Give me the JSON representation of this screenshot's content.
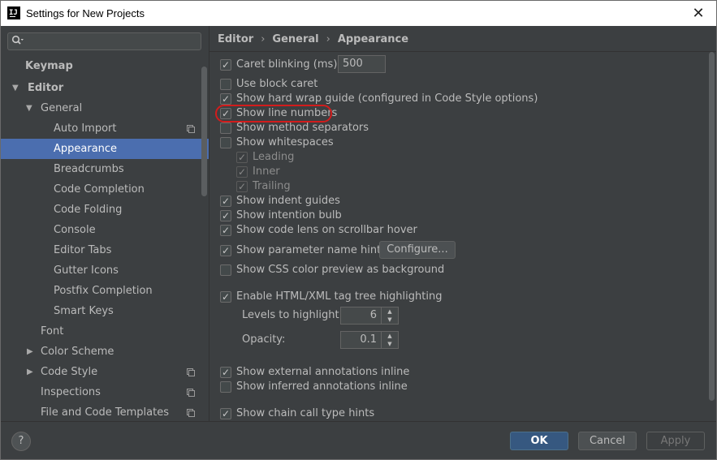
{
  "window": {
    "title": "Settings for New Projects",
    "app_icon_text": "IJ",
    "close_glyph": "✕"
  },
  "sidebar": {
    "search": {
      "value": "",
      "icon": "search-icon"
    },
    "items": [
      {
        "label": "Keymap"
      },
      {
        "label": "Editor",
        "arrow": "▼"
      },
      {
        "label": "General",
        "arrow": "▼"
      },
      {
        "label": "Auto Import"
      },
      {
        "label": "Appearance"
      },
      {
        "label": "Breadcrumbs"
      },
      {
        "label": "Code Completion"
      },
      {
        "label": "Code Folding"
      },
      {
        "label": "Console"
      },
      {
        "label": "Editor Tabs"
      },
      {
        "label": "Gutter Icons"
      },
      {
        "label": "Postfix Completion"
      },
      {
        "label": "Smart Keys"
      },
      {
        "label": "Font"
      },
      {
        "label": "Color Scheme",
        "arrow": "▶"
      },
      {
        "label": "Code Style",
        "arrow": "▶"
      },
      {
        "label": "Inspections"
      },
      {
        "label": "File and Code Templates"
      }
    ]
  },
  "breadcrumb": {
    "part1": "Editor",
    "part2": "General",
    "part3": "Appearance",
    "sep": "›"
  },
  "settings": {
    "caret_blinking": {
      "label": "Caret blinking (ms):",
      "value": "500",
      "checked": true
    },
    "use_block_caret": {
      "label": "Use block caret",
      "checked": false
    },
    "hard_wrap_guide": {
      "label": "Show hard wrap guide (configured in Code Style options)",
      "checked": true
    },
    "line_numbers": {
      "label": "Show line numbers",
      "checked": true
    },
    "method_separators": {
      "label": "Show method separators",
      "checked": false
    },
    "whitespaces": {
      "label": "Show whitespaces",
      "checked": false
    },
    "leading": {
      "label": "Leading",
      "checked": true
    },
    "inner": {
      "label": "Inner",
      "checked": true
    },
    "trailing": {
      "label": "Trailing",
      "checked": true
    },
    "indent_guides": {
      "label": "Show indent guides",
      "checked": true
    },
    "intention_bulb": {
      "label": "Show intention bulb",
      "checked": true
    },
    "code_lens": {
      "label": "Show code lens on scrollbar hover",
      "checked": true
    },
    "param_hints": {
      "label": "Show parameter name hints",
      "checked": true,
      "button": "Configure..."
    },
    "css_color": {
      "label": "Show CSS color preview as background",
      "checked": false
    },
    "tag_tree": {
      "label": "Enable HTML/XML tag tree highlighting",
      "checked": true
    },
    "levels": {
      "label": "Levels to highlight:",
      "value": "6"
    },
    "opacity": {
      "label": "Opacity:",
      "value": "0.1"
    },
    "external_annotations": {
      "label": "Show external annotations inline",
      "checked": true
    },
    "inferred_annotations": {
      "label": "Show inferred annotations inline",
      "checked": false
    },
    "chain_hints": {
      "label": "Show chain call type hints",
      "checked": true
    }
  },
  "footer": {
    "help": "?",
    "ok": "OK",
    "cancel": "Cancel",
    "apply": "Apply"
  },
  "colors": {
    "selection": "#4b6eaf",
    "background": "#3c3f41",
    "ok_button": "#365880",
    "highlight_ring": "#d21c1c"
  }
}
